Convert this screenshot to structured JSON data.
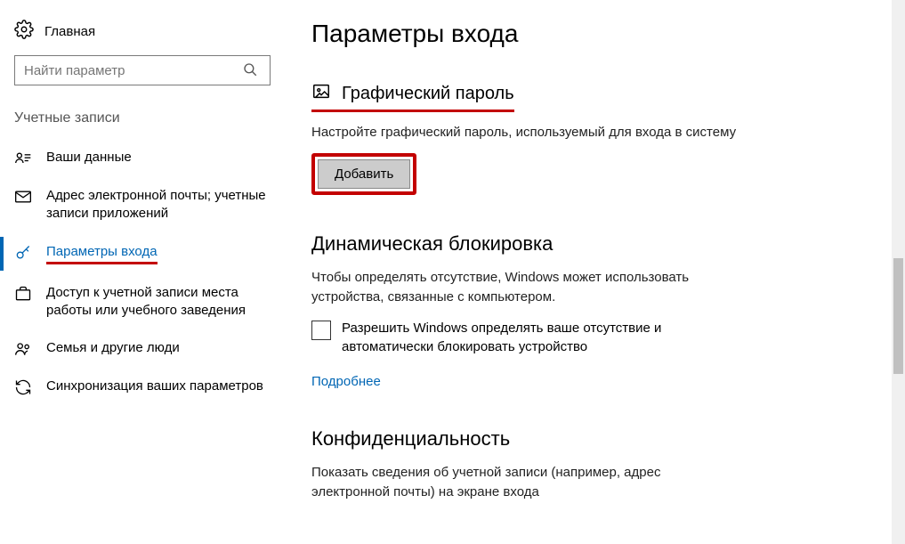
{
  "sidebar": {
    "home_label": "Главная",
    "search_placeholder": "Найти параметр",
    "section_caption": "Учетные записи",
    "items": [
      {
        "label": "Ваши данные"
      },
      {
        "label": "Адрес электронной почты; учетные записи приложений"
      },
      {
        "label": "Параметры входа"
      },
      {
        "label": "Доступ к учетной записи места работы или учебного заведения"
      },
      {
        "label": "Семья и другие люди"
      },
      {
        "label": "Синхронизация ваших параметров"
      }
    ]
  },
  "content": {
    "page_title": "Параметры входа",
    "picture_password": {
      "title": "Графический пароль",
      "desc": "Настройте графический пароль, используемый для входа в систему",
      "add_button": "Добавить"
    },
    "dynamic_lock": {
      "title": "Динамическая блокировка",
      "desc": "Чтобы определять отсутствие, Windows может использовать устройства, связанные с компьютером.",
      "checkbox_label": "Разрешить Windows определять ваше отсутствие и автоматически блокировать устройство",
      "more_link": "Подробнее"
    },
    "privacy": {
      "title": "Конфиденциальность",
      "desc": "Показать сведения об учетной записи (например, адрес электронной почты) на экране входа"
    }
  }
}
